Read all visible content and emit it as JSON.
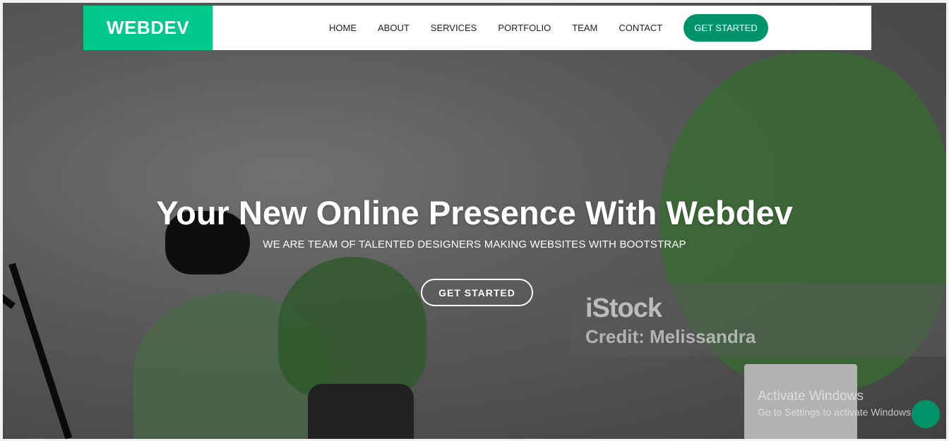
{
  "nav": {
    "logo": "WEBDEV",
    "links": [
      "HOME",
      "ABOUT",
      "SERVICES",
      "PORTFOLIO",
      "TEAM",
      "CONTACT"
    ],
    "cta": "GET STARTED"
  },
  "hero": {
    "title": "Your New Online Presence With Webdev",
    "subtitle": "WE ARE TEAM OF TALENTED DESIGNERS MAKING WEBSITES WITH BOOTSTRAP",
    "button": "GET STARTED"
  },
  "watermark": {
    "brand": "iStock",
    "credit": "Credit: Melissandra"
  },
  "system": {
    "activate_title": "Activate Windows",
    "activate_sub": "Go to Settings to activate Windows."
  },
  "colors": {
    "brand_green": "#00c98a",
    "cta_green": "#00936a"
  },
  "icons": {
    "to_top": "arrow-up-icon"
  }
}
